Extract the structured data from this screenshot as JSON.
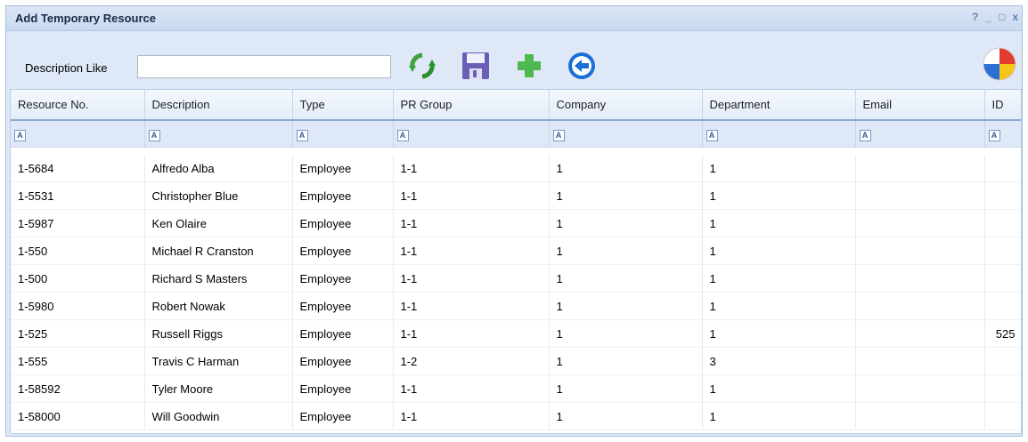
{
  "window": {
    "title": "Add Temporary Resource",
    "controls": [
      "?",
      "_",
      "□",
      "x"
    ]
  },
  "toolbar": {
    "desc_label": "Description Like",
    "desc_value": "",
    "buttons": [
      {
        "name": "refresh",
        "icon": "refresh-icon"
      },
      {
        "name": "save",
        "icon": "save-icon"
      },
      {
        "name": "add",
        "icon": "plus-icon"
      },
      {
        "name": "back",
        "icon": "back-arrow-icon"
      }
    ],
    "logo_icon": "beach-ball-icon"
  },
  "grid": {
    "columns": [
      "Resource No.",
      "Description",
      "Type",
      "PR Group",
      "Company",
      "Department",
      "Email",
      "ID"
    ],
    "filter_icon": "A",
    "rows": [
      [
        "1-5684",
        "Alfredo Alba",
        "Employee",
        "1-1",
        "1",
        "1",
        "",
        ""
      ],
      [
        "1-5531",
        "Christopher Blue",
        "Employee",
        "1-1",
        "1",
        "1",
        "",
        ""
      ],
      [
        "1-5987",
        "Ken Olaire",
        "Employee",
        "1-1",
        "1",
        "1",
        "",
        ""
      ],
      [
        "1-550",
        "Michael R Cranston",
        "Employee",
        "1-1",
        "1",
        "1",
        "",
        ""
      ],
      [
        "1-500",
        "Richard S Masters",
        "Employee",
        "1-1",
        "1",
        "1",
        "",
        ""
      ],
      [
        "1-5980",
        "Robert Nowak",
        "Employee",
        "1-1",
        "1",
        "1",
        "",
        ""
      ],
      [
        "1-525",
        "Russell Riggs",
        "Employee",
        "1-1",
        "1",
        "1",
        "",
        "525"
      ],
      [
        "1-555",
        "Travis C Harman",
        "Employee",
        "1-2",
        "1",
        "3",
        "",
        ""
      ],
      [
        "1-58592",
        "Tyler Moore",
        "Employee",
        "1-1",
        "1",
        "1",
        "",
        ""
      ],
      [
        "1-58000",
        "Will Goodwin",
        "Employee",
        "1-1",
        "1",
        "1",
        "",
        ""
      ]
    ]
  }
}
